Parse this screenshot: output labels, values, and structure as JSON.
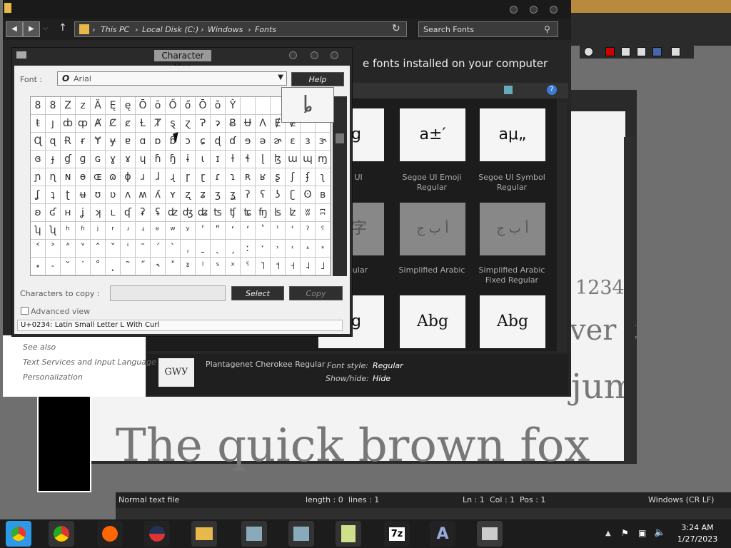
{
  "explorer": {
    "breadcrumb": [
      "This PC",
      "Local Disk (C:)",
      "Windows",
      "Fonts"
    ],
    "search_placeholder": "Search Fonts",
    "heading": "e fonts installed on your computer",
    "see_also": {
      "title": "See also",
      "links": [
        "Text Services and Input Language",
        "Personalization"
      ]
    },
    "font_cards": [
      {
        "preview": "bg",
        "label1": "e UI",
        "label2": ""
      },
      {
        "preview": "a±′",
        "label1": "Segoe UI Emoji",
        "label2": "Regular"
      },
      {
        "preview": "aμ„",
        "label1": "Segoe UI Symbol",
        "label2": "Regular"
      },
      {
        "preview": "本字",
        "label1": "Regular",
        "label2": ""
      },
      {
        "preview": "أ ب ج",
        "label1": "Simplified Arabic",
        "label2": ""
      },
      {
        "preview": "أ ب ج",
        "label1": "Simplified Arabic",
        "label2": "Fixed Regular"
      },
      {
        "preview": "bg",
        "label1": "",
        "label2": ""
      },
      {
        "preview": "Abg",
        "label1": "",
        "label2": ""
      },
      {
        "preview": "Abg",
        "label1": "",
        "label2": ""
      }
    ],
    "details": {
      "thumb": "GWУ",
      "name": "Plantagenet Cherokee Regular",
      "font_style_label": "Font style:",
      "font_style_value": "Regular",
      "show_hide_label": "Show/hide:",
      "show_hide_value": "Hide"
    }
  },
  "charmap": {
    "title": "Character Map",
    "font_label": "Font :",
    "font_value": "Arial",
    "help_label": "Help",
    "preview_char": "ȴ",
    "grid_rows": [
      [
        "8",
        "8",
        "Z",
        "z",
        "Ä",
        "Ę",
        "ę",
        "Ō",
        "ō",
        "Ő",
        "ő",
        "Ō",
        "ŏ",
        "Ŷ",
        "",
        ""
      ],
      [
        "ŧ",
        "ȷ",
        "ȸ",
        "ȹ",
        "Ⱥ",
        "Ȼ",
        "ȼ",
        "Ƚ",
        "Ⱦ",
        "ȿ",
        "ɀ",
        "Ɂ",
        "ɂ",
        "Ƀ",
        "Ʉ",
        "Ʌ",
        "Ɇ",
        "ɇ"
      ],
      [
        "Ɋ",
        "ɋ",
        "Ɍ",
        "ɍ",
        "Ɏ",
        "ɏ",
        "ɐ",
        "ɑ",
        "ɒ",
        "ɓ",
        "ɔ",
        "ɕ",
        "ɖ",
        "ɗ",
        "ɘ",
        "ə",
        "ɚ",
        "ɛ",
        "ɜ",
        "ɝ"
      ],
      [
        "ɞ",
        "ɟ",
        "ɠ",
        "ɡ",
        "ɢ",
        "ɣ",
        "ɤ",
        "ɥ",
        "ɦ",
        "ɧ",
        "ɨ",
        "ɩ",
        "ɪ",
        "ɫ",
        "ɬ",
        "ɭ",
        "ɮ",
        "ɯ",
        "ɰ",
        "ɱ"
      ],
      [
        "ɲ",
        "ɳ",
        "ɴ",
        "ɵ",
        "ɶ",
        "ɷ",
        "ɸ",
        "ɹ",
        "ɺ",
        "ɻ",
        "ɼ",
        "ɽ",
        "ɾ",
        "ɿ",
        "ʀ",
        "ʁ",
        "ʂ",
        "ʃ",
        "ʄ",
        "ʅ"
      ],
      [
        "ʆ",
        "ʇ",
        "ʈ",
        "ʉ",
        "ʊ",
        "ʋ",
        "ʌ",
        "ʍ",
        "ʎ",
        "ʏ",
        "ʐ",
        "ʑ",
        "ʒ",
        "ʓ",
        "ʔ",
        "ʕ",
        "ʖ",
        "ʗ",
        "ʘ",
        "ʙ"
      ],
      [
        "ʚ",
        "ʛ",
        "ʜ",
        "ʝ",
        "ʞ",
        "ʟ",
        "ʠ",
        "ʡ",
        "ʢ",
        "ʣ",
        "ʤ",
        "ʥ",
        "ʦ",
        "ʧ",
        "ʨ",
        "ʩ",
        "ʪ",
        "ʫ",
        "ʬ",
        "ʭ"
      ],
      [
        "ʮ",
        "ʯ",
        "ʰ",
        "ʱ",
        "ʲ",
        "ʳ",
        "ʴ",
        "ʵ",
        "ʶ",
        "ʷ",
        "ʸ",
        "ʹ",
        "ʺ",
        "ʻ",
        "ʼ",
        "ʽ",
        "ʾ",
        "ʿ",
        "ˀ",
        "ˁ"
      ],
      [
        "˂",
        "˃",
        "˄",
        "˅",
        "ˆ",
        "ˇ",
        "ˈ",
        "ˉ",
        "ˊ",
        "ˋ",
        "ˌ",
        "ˍ",
        "ˎ",
        "ˏ",
        "ː",
        "ˑ",
        "˒",
        "˓",
        "˔",
        "˕"
      ],
      [
        "˖",
        "˗",
        "˘",
        "˙",
        "˚",
        "˛",
        "˜",
        "˝",
        "˞",
        "˟",
        "ˠ",
        "ˡ",
        "ˢ",
        "ˣ",
        "ˤ",
        "˥",
        "˦",
        "˧",
        "˨",
        "˩"
      ]
    ],
    "chars_to_copy_label": "Characters to copy :",
    "select_label": "Select",
    "copy_label": "Copy",
    "advanced_view_label": "Advanced view",
    "status": "U+0234: Latin Small Letter L With Curl"
  },
  "notepad": {
    "big_numbers": "1234",
    "big_text_line1": "ver t",
    "big_text_line2": "jum",
    "big_text_line3": "The quick brown fox",
    "status": {
      "type": "Normal text file",
      "length": "length : 0",
      "lines": "lines : 1",
      "ln": "Ln : 1",
      "col": "Col : 1",
      "pos": "Pos : 1",
      "eol": "Windows (CR LF)"
    }
  },
  "taskbar": {
    "time": "3:24 AM",
    "date": "1/27/2023",
    "sevenzip_label": "7z"
  }
}
